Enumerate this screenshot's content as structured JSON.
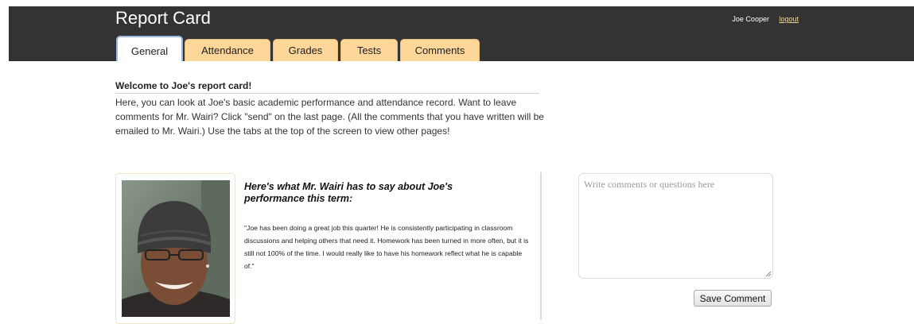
{
  "header": {
    "title": "Report Card",
    "user_name": "Joe Cooper",
    "logout_label": "logout"
  },
  "tabs": [
    {
      "label": "General",
      "active": true
    },
    {
      "label": "Attendance",
      "active": false
    },
    {
      "label": "Grades",
      "active": false
    },
    {
      "label": "Tests",
      "active": false
    },
    {
      "label": "Comments",
      "active": false
    }
  ],
  "welcome": {
    "heading": "Welcome to Joe's report card!",
    "body": "Here, you can look at Joe's basic academic performance and attendance record. Want to leave comments for Mr. Wairi? Click \"send\" on the last page. (All the comments that you have written will be emailed to Mr. Wairi.) Use the tabs at the top of the screen to view other pages!"
  },
  "teacher": {
    "heading": "Here's what Mr. Wairi has to say about Joe's performance this term:",
    "quote": "\"Joe has been doing a great job this quarter! He is consistently participating in classroom discussions and helping others that need it. Homework has been turned in more often, but it is still not 100% of the time. I would really like to have his homework reflect what he is capable of.\""
  },
  "comment": {
    "placeholder": "Write comments or questions here",
    "value": "",
    "save_label": "Save Comment"
  },
  "colors": {
    "header_bg": "#333333",
    "tab_bg": "#fdd79a",
    "active_tab_border": "#9bb7e6",
    "logout_link": "#f5d79a"
  }
}
